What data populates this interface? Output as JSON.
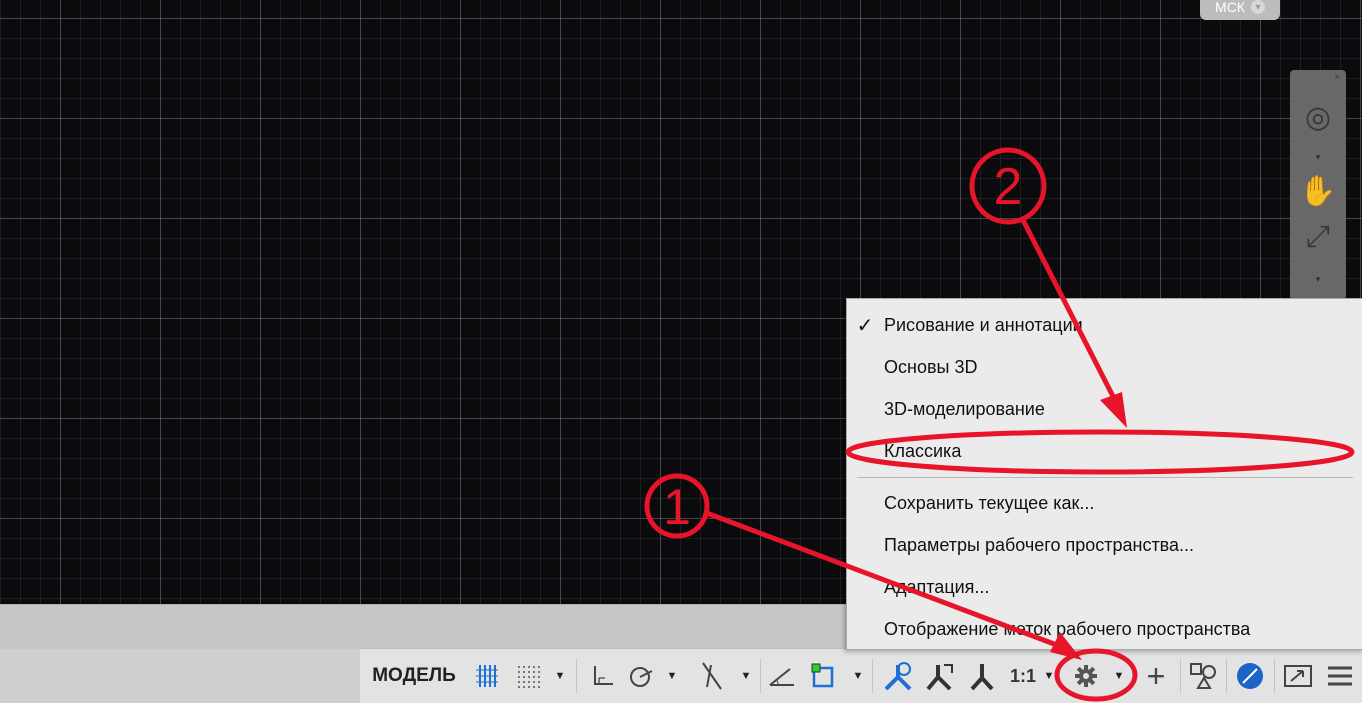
{
  "viewport": {
    "ucs_badge": "МСК"
  },
  "workspace_menu": {
    "items": [
      {
        "label": "Рисование и аннотации",
        "checked": true
      },
      {
        "label": "Основы 3D",
        "checked": false
      },
      {
        "label": "3D-моделирование",
        "checked": false
      },
      {
        "label": "Классика",
        "checked": false
      },
      {
        "label": "Сохранить текущее как...",
        "checked": false
      },
      {
        "label": "Параметры рабочего пространства...",
        "checked": false
      },
      {
        "label": "Адаптация...",
        "checked": false
      },
      {
        "label": "Отображение меток рабочего пространства",
        "checked": false
      }
    ],
    "check_glyph": "✓"
  },
  "status_bar": {
    "model_label": "МОДЕЛЬ",
    "annotation_scale": "1:1"
  },
  "annotations": {
    "marker_1": "1",
    "marker_2": "2",
    "color": "#e8142a"
  },
  "icons": [
    "grid-display-icon",
    "snap-mode-icon",
    "ortho-mode-icon",
    "polar-tracking-icon",
    "isodraft-icon",
    "object-snap-tracking-icon",
    "object-snap-icon",
    "annotation-visibility-icon",
    "auto-scale-icon",
    "annotation-scale-icon",
    "workspace-gear-icon",
    "plus-icon",
    "isolate-objects-icon",
    "hardware-acceleration-icon",
    "fullscreen-icon",
    "customization-menu-icon"
  ]
}
